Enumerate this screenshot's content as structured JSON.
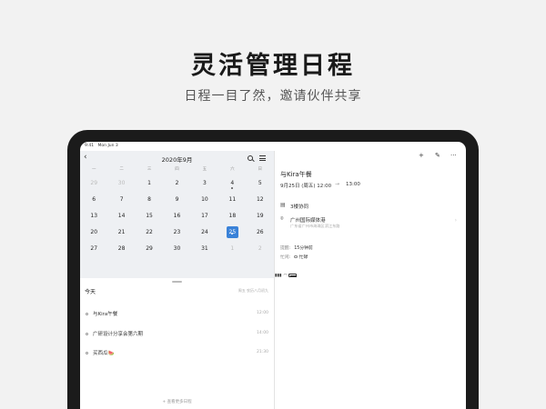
{
  "hero": {
    "title": "灵活管理日程",
    "subtitle": "日程一目了然，邀请伙伴共享"
  },
  "status_bar": {
    "time": "9:41",
    "date": "Mon Jun 3"
  },
  "calendar": {
    "title": "2020年9月",
    "weekdays": [
      "一",
      "二",
      "三",
      "四",
      "五",
      "六",
      "日"
    ],
    "weeks": [
      [
        {
          "d": "29",
          "other": true
        },
        {
          "d": "30",
          "other": true
        },
        {
          "d": "1"
        },
        {
          "d": "2"
        },
        {
          "d": "3"
        },
        {
          "d": "4",
          "dot": true
        },
        {
          "d": "5"
        }
      ],
      [
        {
          "d": "6"
        },
        {
          "d": "7"
        },
        {
          "d": "8"
        },
        {
          "d": "9"
        },
        {
          "d": "10"
        },
        {
          "d": "11"
        },
        {
          "d": "12"
        }
      ],
      [
        {
          "d": "13"
        },
        {
          "d": "14"
        },
        {
          "d": "15"
        },
        {
          "d": "16"
        },
        {
          "d": "17"
        },
        {
          "d": "18"
        },
        {
          "d": "19"
        }
      ],
      [
        {
          "d": "20"
        },
        {
          "d": "21"
        },
        {
          "d": "22"
        },
        {
          "d": "23"
        },
        {
          "d": "24"
        },
        {
          "d": "25",
          "selected": true,
          "dot": true
        },
        {
          "d": "26"
        }
      ],
      [
        {
          "d": "27"
        },
        {
          "d": "28"
        },
        {
          "d": "29"
        },
        {
          "d": "30"
        },
        {
          "d": "31"
        },
        {
          "d": "1",
          "other": true
        },
        {
          "d": "2",
          "other": true
        }
      ]
    ]
  },
  "today": {
    "label": "今天",
    "hint": "周五 农历八月初九",
    "events": [
      {
        "title": "与Kira午餐",
        "time": "12:00"
      },
      {
        "title": "广研设计分享会第六期",
        "time": "14:00"
      },
      {
        "title": "买西瓜🍉",
        "time": "21:30"
      }
    ],
    "more": "+ 查看更多日程"
  },
  "detail": {
    "toolbar": {
      "add": "+",
      "edit": "✎",
      "more": "···"
    },
    "title": "与Kira午餐",
    "start": "9月25日 (周五) 12:00",
    "arrow": "→",
    "end": "13:00",
    "room": "3楼协同",
    "place": "广州国际媒体港",
    "address": "广东省广州市海珠区滨江东路",
    "reminder_label": "提醒:",
    "reminder_value": "15分钟前",
    "status_label": "忙闲:",
    "status_value": "忙碌"
  },
  "colors": {
    "accent": "#3a82d8",
    "calendar_bg": "#eef0f3",
    "device": "#1b1b1b"
  }
}
